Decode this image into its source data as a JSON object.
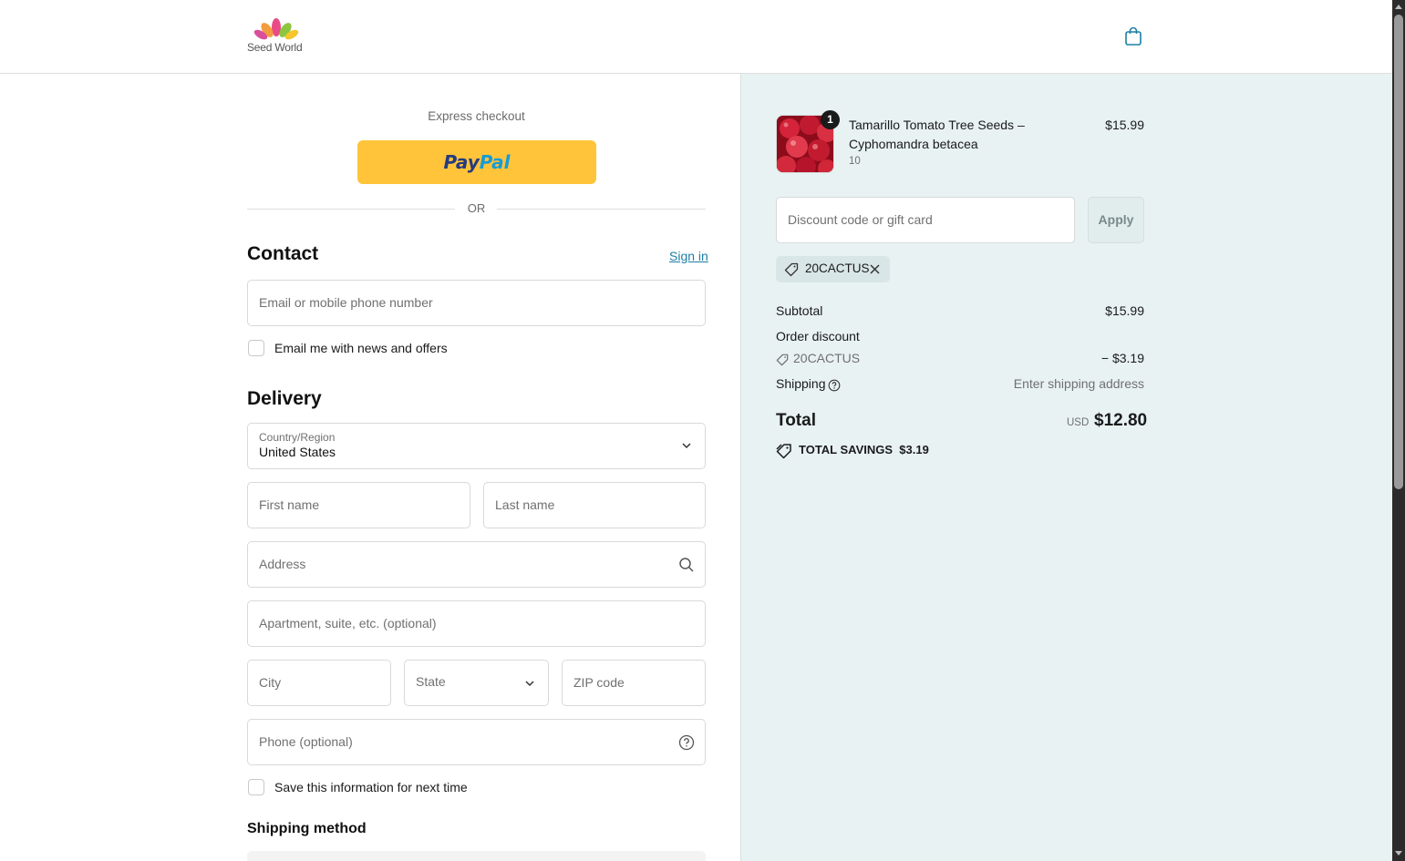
{
  "header": {
    "logo_text": "Seed World",
    "cart_icon": "shopping-bag-icon"
  },
  "express": {
    "label": "Express checkout",
    "paypal_part1": "Pay",
    "paypal_part2": "Pal",
    "or_label": "OR"
  },
  "contact": {
    "title": "Contact",
    "sign_in": "Sign in",
    "email_placeholder": "Email or mobile phone number",
    "news_checkbox_label": "Email me with news and offers"
  },
  "delivery": {
    "title": "Delivery",
    "country_label": "Country/Region",
    "country_value": "United States",
    "first_name": "First name",
    "last_name": "Last name",
    "address": "Address",
    "apartment": "Apartment, suite, etc. (optional)",
    "city": "City",
    "state": "State",
    "zip": "ZIP code",
    "phone": "Phone (optional)",
    "save_info_label": "Save this information for next time"
  },
  "shipping_method": {
    "title": "Shipping method"
  },
  "summary": {
    "product": {
      "name": "Tamarillo Tomato Tree Seeds – Cyphomandra betacea",
      "variant": "10",
      "price": "$15.99",
      "quantity": "1"
    },
    "discount_placeholder": "Discount code or gift card",
    "apply_label": "Apply",
    "applied_code": "20CACTUS",
    "subtotal_label": "Subtotal",
    "subtotal_value": "$15.99",
    "order_discount_label": "Order discount",
    "discount_code": "20CACTUS",
    "discount_value": "− $3.19",
    "shipping_label": "Shipping",
    "shipping_value": "Enter shipping address",
    "total_label": "Total",
    "total_currency": "USD",
    "total_value": "$12.80",
    "savings_label": "TOTAL SAVINGS",
    "savings_value": "$3.19"
  },
  "colors": {
    "accent_link": "#1d7fa6",
    "paypal_yellow": "#ffc439",
    "summary_bg": "#e8f2f3"
  }
}
